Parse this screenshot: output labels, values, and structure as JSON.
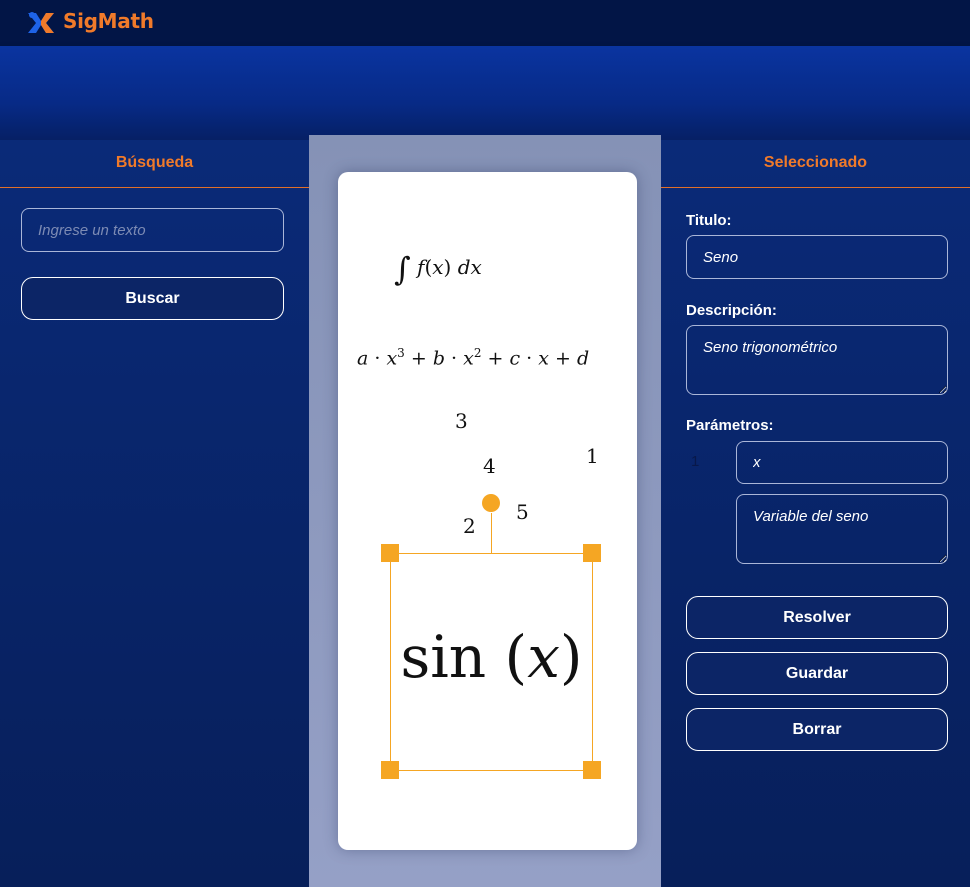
{
  "app": {
    "name": "SigMath"
  },
  "colors": {
    "accent": "#f07a2a",
    "selection": "#f5a623",
    "background": "#0a2168"
  },
  "search_panel": {
    "title": "Búsqueda",
    "search_placeholder": "Ingrese un texto",
    "search_value": "",
    "search_button": "Buscar"
  },
  "canvas": {
    "formulas": {
      "integral": "∫ f(x) dx",
      "polynomial": "a · x³ + b · x² + c · x + d",
      "selected": "sin(x)"
    },
    "labels": [
      "1",
      "2",
      "3",
      "4",
      "5"
    ]
  },
  "selected_panel": {
    "title": "Seleccionado",
    "title_label": "Titulo:",
    "title_value": "Seno",
    "description_label": "Descripción:",
    "description_value": "Seno trigonométrico",
    "params_label": "Parámetros:",
    "params": [
      {
        "index": "1",
        "name": "x",
        "description": "Variable del seno"
      }
    ],
    "buttons": {
      "solve": "Resolver",
      "save": "Guardar",
      "delete": "Borrar"
    }
  }
}
